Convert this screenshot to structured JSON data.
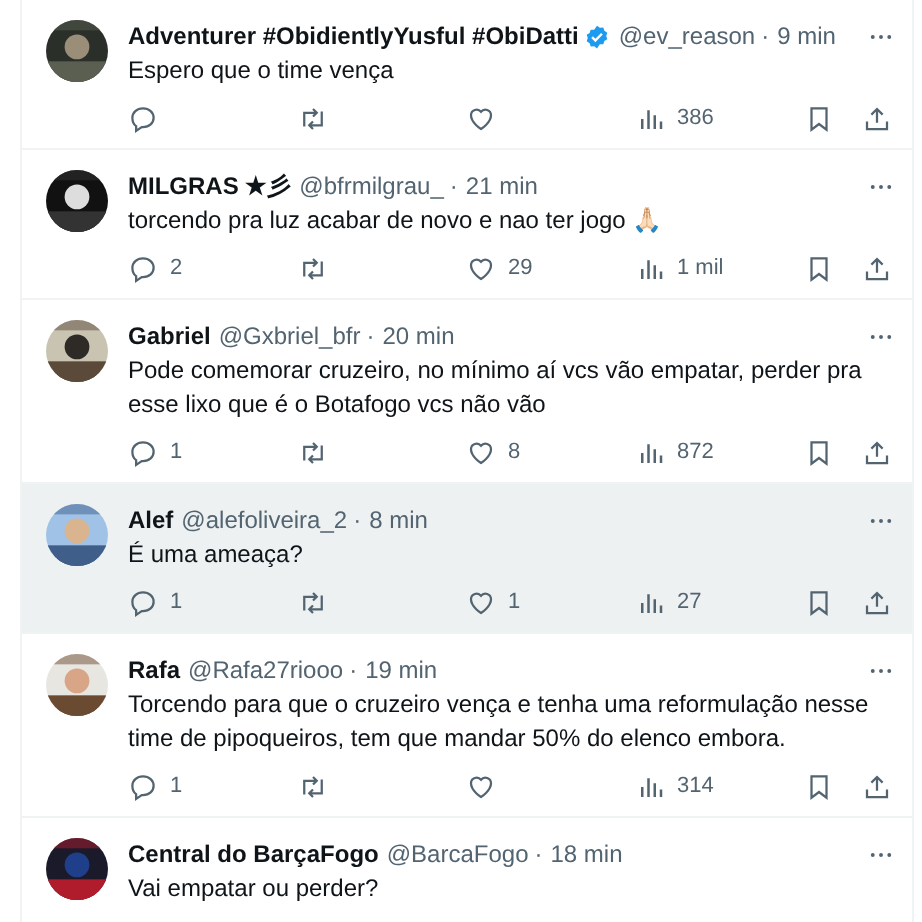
{
  "tweets": [
    {
      "name": "Adventurer #ObidientlyYusful #ObiDatti",
      "verified": true,
      "handle": "@ev_reason",
      "separator": "·",
      "time": "9 min",
      "text": "Espero que o time vença",
      "highlighted": false,
      "views": "386"
    },
    {
      "name": "MILGRAS ★彡",
      "verified": false,
      "handle": "@bfrmilgrau_",
      "separator": "·",
      "time": "21 min",
      "text": "torcendo pra luz acabar de novo e nao ter jogo 🙏🏻",
      "highlighted": false,
      "replies": "2",
      "likes": "29",
      "views": "1 mil"
    },
    {
      "name": "Gabriel",
      "verified": false,
      "handle": "@Gxbriel_bfr",
      "separator": "·",
      "time": "20 min",
      "text": "Pode comemorar cruzeiro, no mínimo aí vcs vão empatar, perder pra esse lixo que é o Botafogo vcs não vão",
      "highlighted": false,
      "replies": "1",
      "likes": "8",
      "views": "872"
    },
    {
      "name": "Alef",
      "verified": false,
      "handle": "@alefoliveira_2",
      "separator": "·",
      "time": "8 min",
      "text": "É uma ameaça?",
      "highlighted": true,
      "replies": "1",
      "likes": "1",
      "views": "27"
    },
    {
      "name": "Rafa",
      "verified": false,
      "handle": "@Rafa27riooo",
      "separator": "·",
      "time": "19 min",
      "text": "Torcendo para que o cruzeiro vença e tenha uma reformulação nesse time de pipoqueiros, tem que mandar 50% do elenco embora.",
      "highlighted": false,
      "replies": "1",
      "views": "314"
    },
    {
      "name": "Central do BarçaFogo",
      "verified": false,
      "handle": "@BarcaFogo",
      "separator": "·",
      "time": "18 min",
      "text": "Vai empatar ou perder?",
      "highlighted": false
    }
  ]
}
